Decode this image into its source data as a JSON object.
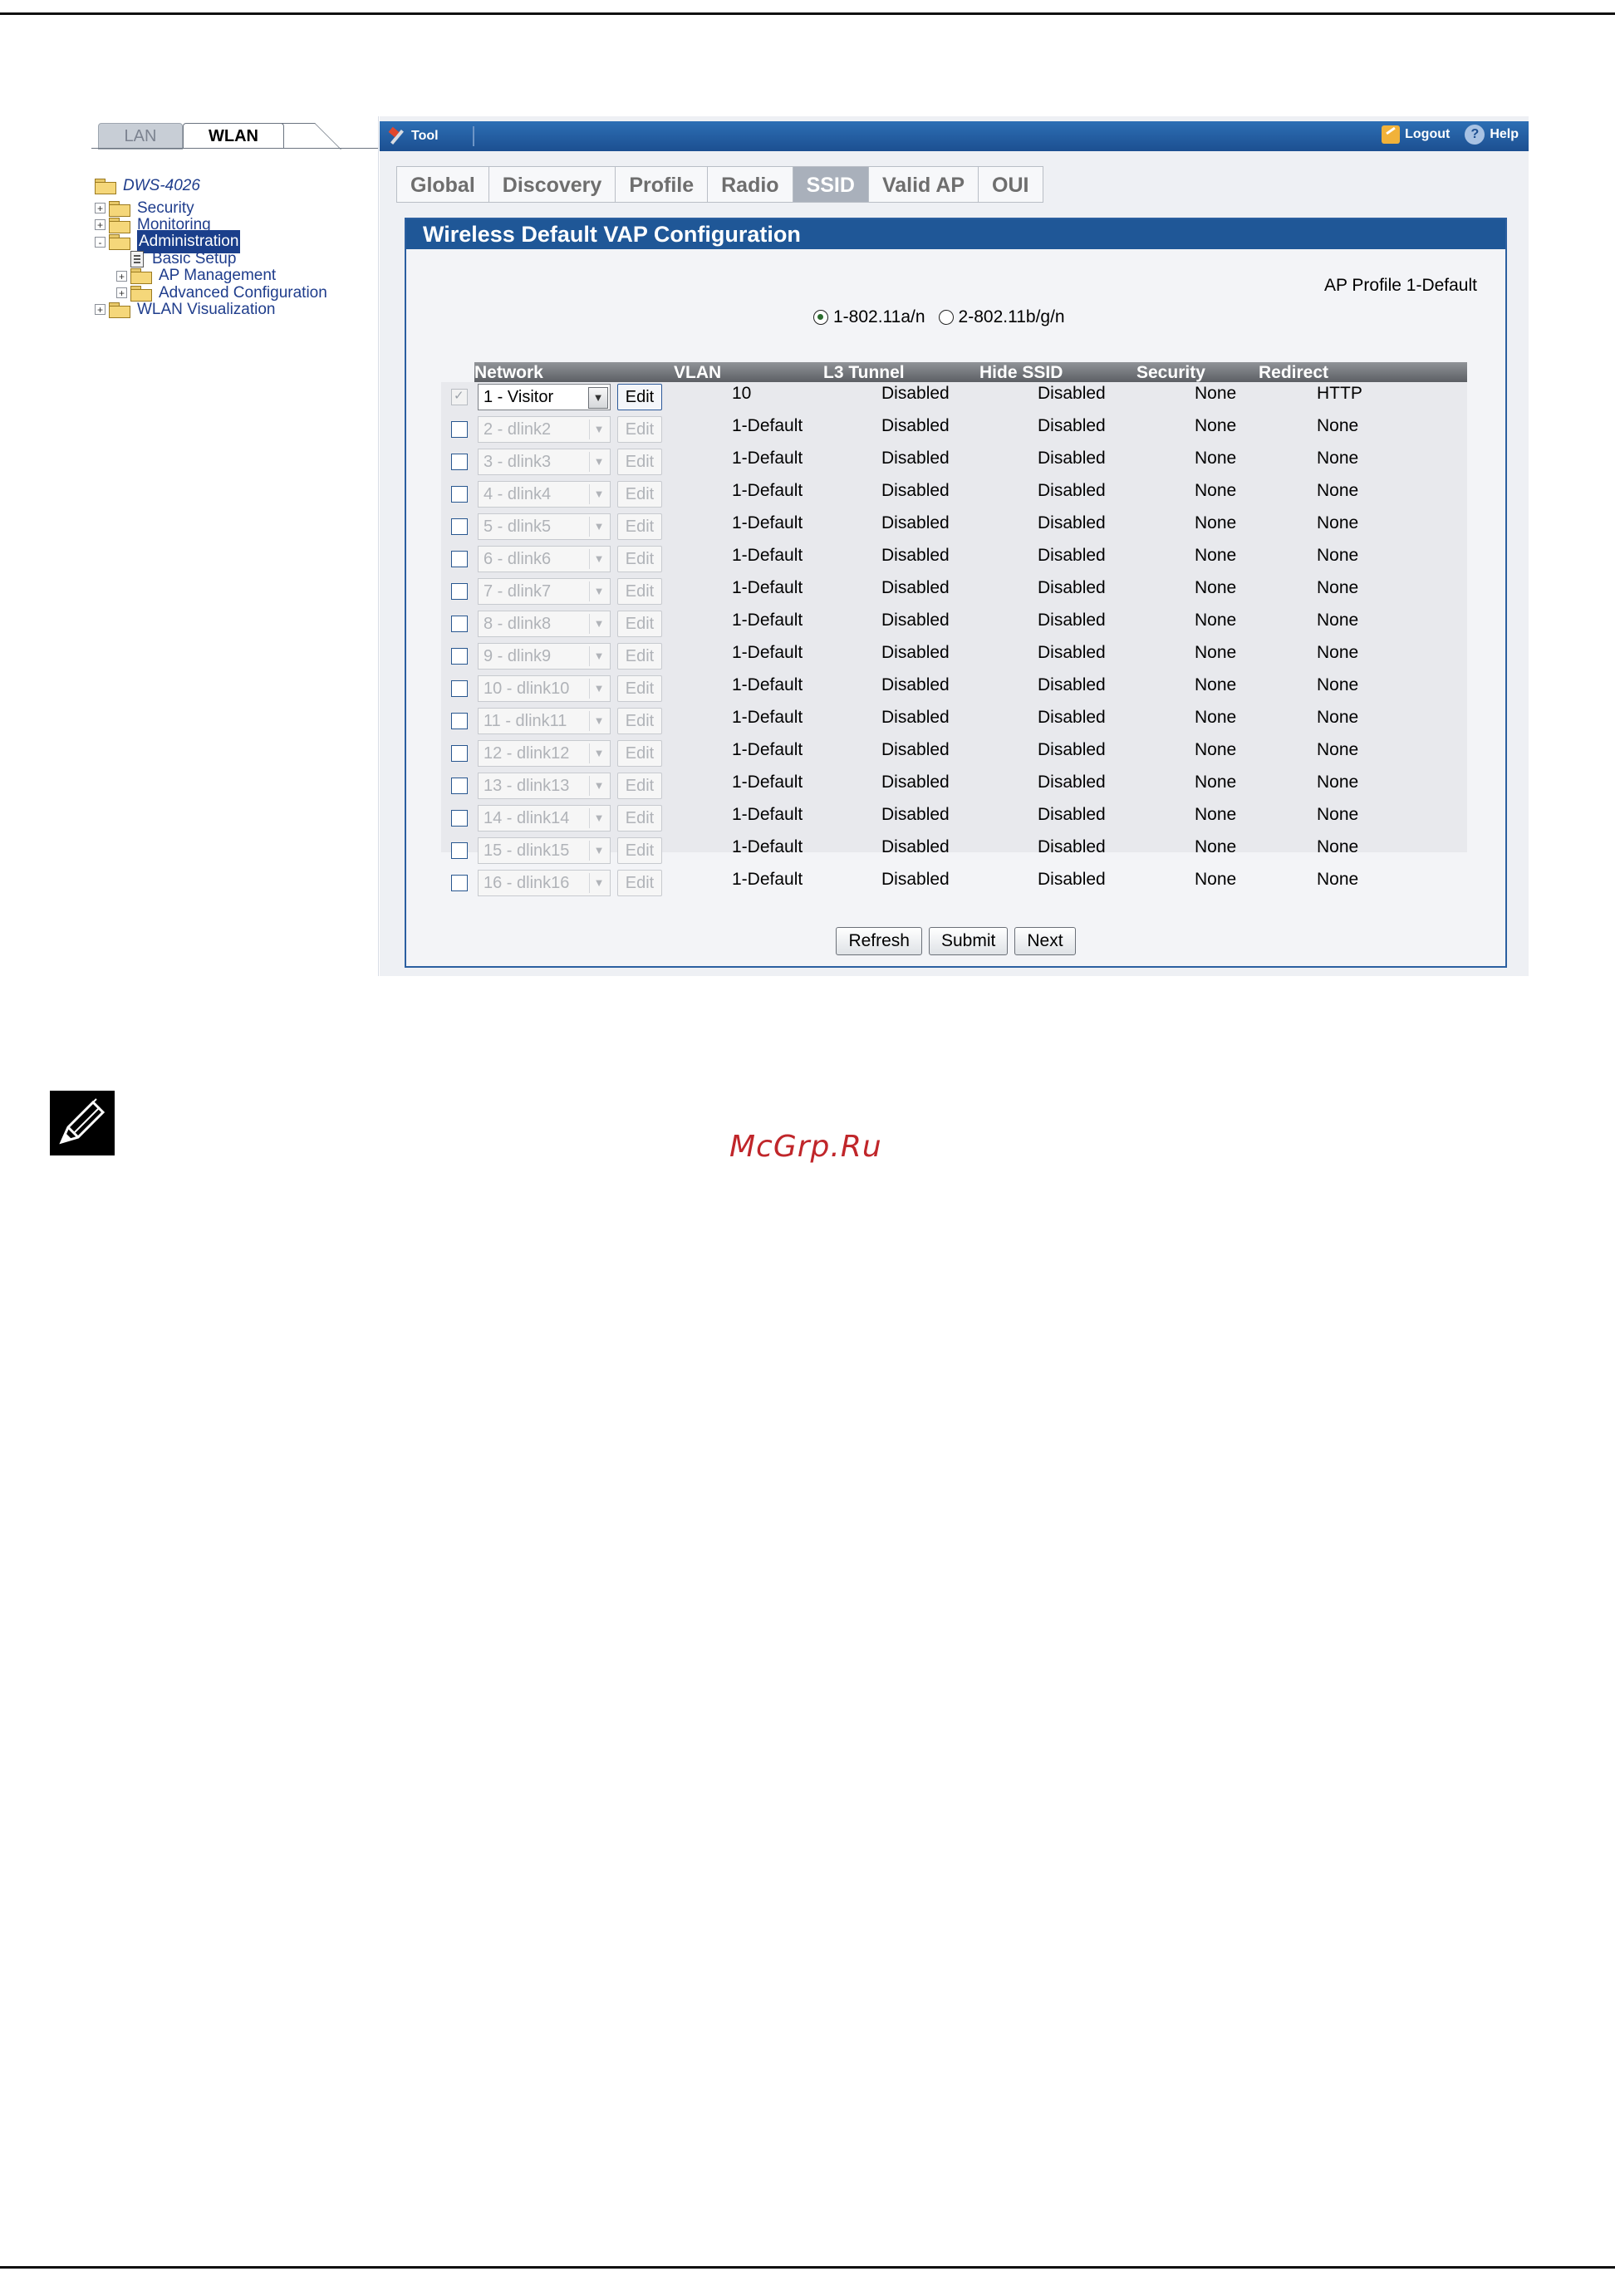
{
  "left_nav": {
    "tabs": [
      "LAN",
      "WLAN"
    ],
    "device": "DWS-4026",
    "tree": [
      {
        "label": "Security",
        "expander": "+",
        "level": 0
      },
      {
        "label": "Monitoring",
        "expander": "+",
        "level": 0
      },
      {
        "label": "Administration",
        "expander": "-",
        "level": 0,
        "selected": true
      },
      {
        "label": "Basic Setup",
        "expander": "",
        "level": 1
      },
      {
        "label": "AP Management",
        "expander": "+",
        "level": 1
      },
      {
        "label": "Advanced Configuration",
        "expander": "+",
        "level": 1
      },
      {
        "label": "WLAN Visualization",
        "expander": "+",
        "level": 0
      }
    ]
  },
  "toolbar": {
    "tool_label": "Tool",
    "logout_label": "Logout",
    "help_label": "Help",
    "help_glyph": "?"
  },
  "subtabs": [
    "Global",
    "Discovery",
    "Profile",
    "Radio",
    "SSID",
    "Valid AP",
    "OUI"
  ],
  "active_subtab": "SSID",
  "panel": {
    "title": "Wireless Default VAP Configuration",
    "ap_profile": "AP Profile 1-Default",
    "radio_options": [
      "1-802.11a/n",
      "2-802.11b/g/n"
    ],
    "radio_selected": 0,
    "columns": [
      "Network",
      "VLAN",
      "L3 Tunnel",
      "Hide SSID",
      "Security",
      "Redirect"
    ],
    "edit_label": "Edit",
    "rows": [
      {
        "network": "1 - Visitor",
        "vlan": "10",
        "l3": "Disabled",
        "hide": "Disabled",
        "security": "None",
        "redirect": "HTTP",
        "enabled": true
      },
      {
        "network": "2 - dlink2",
        "vlan": "1-Default",
        "l3": "Disabled",
        "hide": "Disabled",
        "security": "None",
        "redirect": "None",
        "enabled": false
      },
      {
        "network": "3 - dlink3",
        "vlan": "1-Default",
        "l3": "Disabled",
        "hide": "Disabled",
        "security": "None",
        "redirect": "None",
        "enabled": false
      },
      {
        "network": "4 - dlink4",
        "vlan": "1-Default",
        "l3": "Disabled",
        "hide": "Disabled",
        "security": "None",
        "redirect": "None",
        "enabled": false
      },
      {
        "network": "5 - dlink5",
        "vlan": "1-Default",
        "l3": "Disabled",
        "hide": "Disabled",
        "security": "None",
        "redirect": "None",
        "enabled": false
      },
      {
        "network": "6 - dlink6",
        "vlan": "1-Default",
        "l3": "Disabled",
        "hide": "Disabled",
        "security": "None",
        "redirect": "None",
        "enabled": false
      },
      {
        "network": "7 - dlink7",
        "vlan": "1-Default",
        "l3": "Disabled",
        "hide": "Disabled",
        "security": "None",
        "redirect": "None",
        "enabled": false
      },
      {
        "network": "8 - dlink8",
        "vlan": "1-Default",
        "l3": "Disabled",
        "hide": "Disabled",
        "security": "None",
        "redirect": "None",
        "enabled": false
      },
      {
        "network": "9 - dlink9",
        "vlan": "1-Default",
        "l3": "Disabled",
        "hide": "Disabled",
        "security": "None",
        "redirect": "None",
        "enabled": false
      },
      {
        "network": "10 - dlink10",
        "vlan": "1-Default",
        "l3": "Disabled",
        "hide": "Disabled",
        "security": "None",
        "redirect": "None",
        "enabled": false
      },
      {
        "network": "11 - dlink11",
        "vlan": "1-Default",
        "l3": "Disabled",
        "hide": "Disabled",
        "security": "None",
        "redirect": "None",
        "enabled": false
      },
      {
        "network": "12 - dlink12",
        "vlan": "1-Default",
        "l3": "Disabled",
        "hide": "Disabled",
        "security": "None",
        "redirect": "None",
        "enabled": false
      },
      {
        "network": "13 - dlink13",
        "vlan": "1-Default",
        "l3": "Disabled",
        "hide": "Disabled",
        "security": "None",
        "redirect": "None",
        "enabled": false
      },
      {
        "network": "14 - dlink14",
        "vlan": "1-Default",
        "l3": "Disabled",
        "hide": "Disabled",
        "security": "None",
        "redirect": "None",
        "enabled": false
      },
      {
        "network": "15 - dlink15",
        "vlan": "1-Default",
        "l3": "Disabled",
        "hide": "Disabled",
        "security": "None",
        "redirect": "None",
        "enabled": false
      },
      {
        "network": "16 - dlink16",
        "vlan": "1-Default",
        "l3": "Disabled",
        "hide": "Disabled",
        "security": "None",
        "redirect": "None",
        "enabled": false
      }
    ],
    "buttons": [
      "Refresh",
      "Submit",
      "Next"
    ]
  },
  "watermark": "McGrp.Ru",
  "colors": {
    "toolbar_blue": "#1f5797",
    "selected_nav": "#1b3f8b",
    "watermark_red": "#c0262a"
  }
}
